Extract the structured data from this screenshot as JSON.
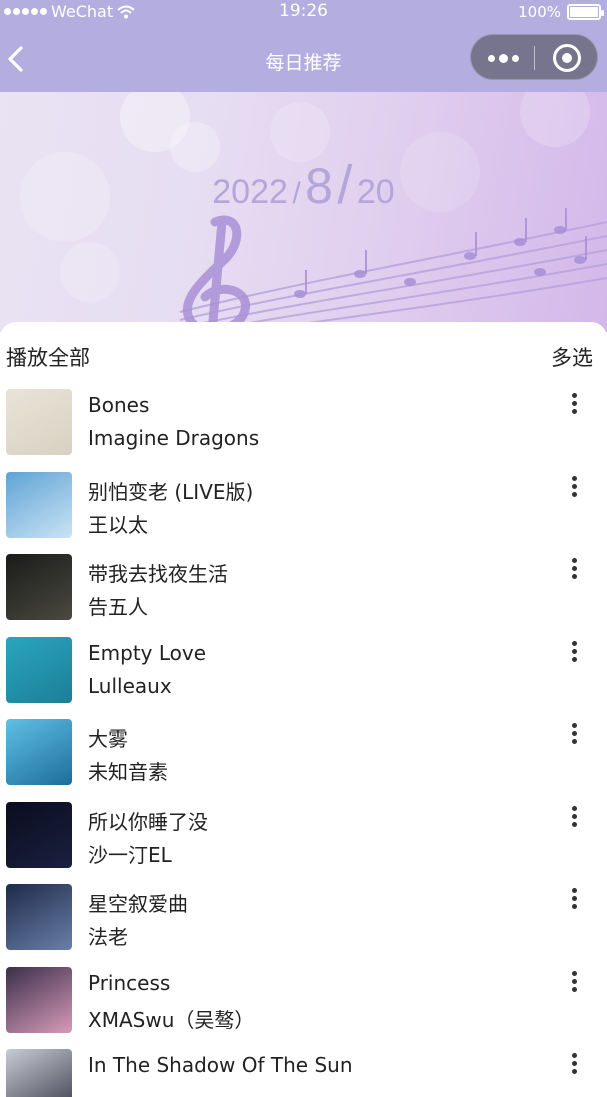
{
  "status_bar": {
    "carrier": "WeChat",
    "time": "19:26",
    "battery_text": "100%",
    "battery_level": 1.0,
    "icons": [
      "signal-dots-icon",
      "wifi-icon",
      "battery-icon"
    ]
  },
  "nav": {
    "title": "每日推荐",
    "icons": [
      "back-chevron-icon",
      "more-dots-icon",
      "close-target-icon"
    ]
  },
  "banner": {
    "year": "2022",
    "month": "8",
    "day": "20",
    "separator": "/",
    "decoration": "treble-clef-and-music-notes"
  },
  "toolbar": {
    "play_all": "播放全部",
    "multi_select": "多选"
  },
  "songs": [
    {
      "title": "Bones",
      "artist": "Imagine Dragons",
      "cover_colors": [
        "#e9e4d8",
        "#d8d1c2"
      ]
    },
    {
      "title": "别怕变老 (LIVE版)",
      "artist": "王以太",
      "cover_colors": [
        "#5fa3d6",
        "#c9e3f3"
      ]
    },
    {
      "title": "带我去找夜生活",
      "artist": "告五人",
      "cover_colors": [
        "#1a1a1a",
        "#4a4a40"
      ]
    },
    {
      "title": "Empty Love",
      "artist": "Lulleaux",
      "cover_colors": [
        "#2aa6bf",
        "#1b7f96"
      ]
    },
    {
      "title": "大雾",
      "artist": "未知音素",
      "cover_colors": [
        "#5fc0e6",
        "#1d6e9a"
      ]
    },
    {
      "title": "所以你睡了没",
      "artist": "沙一汀EL",
      "cover_colors": [
        "#0a0d1e",
        "#1a2040"
      ]
    },
    {
      "title": "星空叙爱曲",
      "artist": "法老",
      "cover_colors": [
        "#1e2b4a",
        "#6a7fa8"
      ]
    },
    {
      "title": "Princess",
      "artist": "XMASwu（吴骜）",
      "cover_colors": [
        "#3a2f4a",
        "#d79ab8"
      ]
    },
    {
      "title": "In The Shadow Of The Sun",
      "artist": "",
      "cover_colors": [
        "#c9ccd6",
        "#3a3d4a"
      ]
    }
  ],
  "colors": {
    "header_bg": "#b4ade0",
    "capsule_bg": "#77748e",
    "date_color": "#b3a6d8",
    "text": "#222222"
  }
}
